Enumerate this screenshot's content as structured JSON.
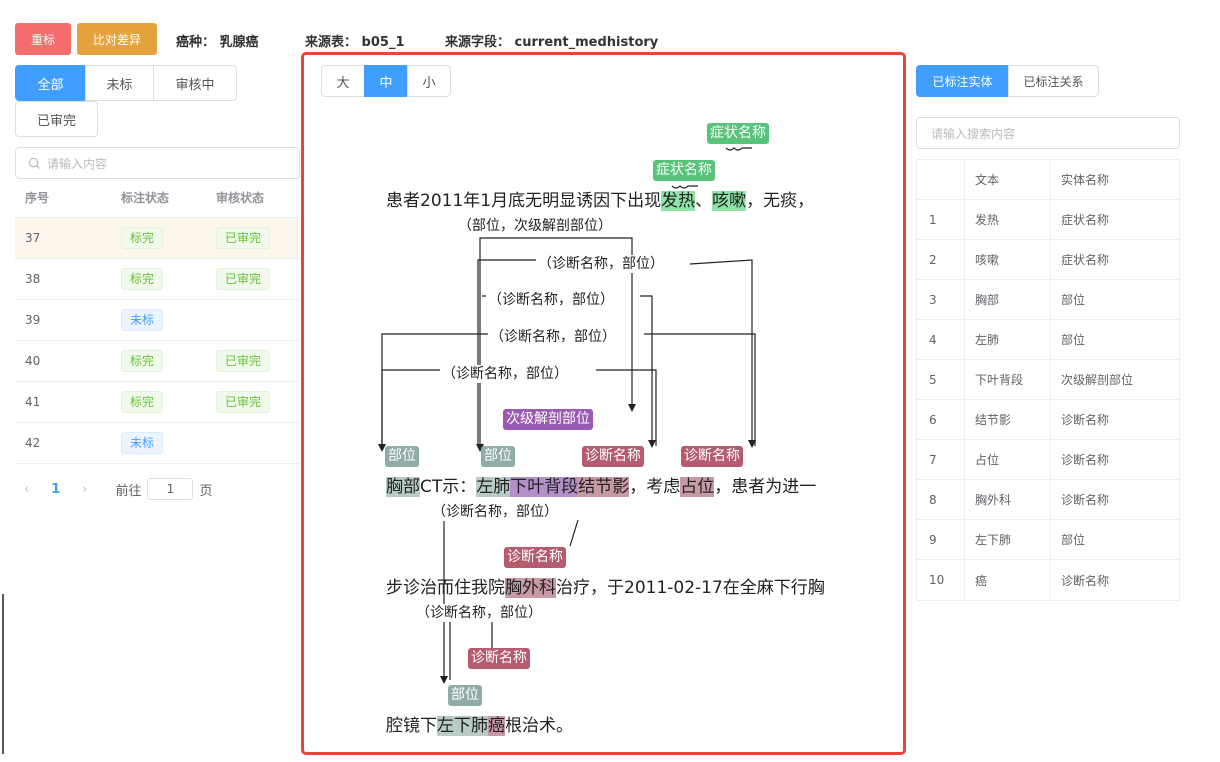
{
  "toolbar": {
    "reset_label": "重标",
    "compare_label": "比对差异",
    "cancer_type_label": "癌种：",
    "cancer_type_value": "乳腺癌",
    "source_table_label": "来源表：",
    "source_table_value": "b05_1",
    "source_field_label": "来源字段：",
    "source_field_value": "current_medhistory"
  },
  "left_panel": {
    "filters": [
      "全部",
      "未标",
      "审核中",
      "已审完"
    ],
    "search_placeholder": "请输入内容",
    "columns": [
      "序号",
      "标注状态",
      "审核状态"
    ],
    "rows": [
      {
        "id": "37",
        "label_status": "标完",
        "review_status": "已审完"
      },
      {
        "id": "38",
        "label_status": "标完",
        "review_status": "已审完"
      },
      {
        "id": "39",
        "label_status": "未标",
        "review_status": ""
      },
      {
        "id": "40",
        "label_status": "标完",
        "review_status": "已审完"
      },
      {
        "id": "41",
        "label_status": "标完",
        "review_status": "已审完"
      },
      {
        "id": "42",
        "label_status": "未标",
        "review_status": ""
      }
    ],
    "pagination": {
      "current": "1",
      "goto_label": "前往",
      "goto_value": "1",
      "page_suffix": "页"
    }
  },
  "main": {
    "size_options": [
      "大",
      "中",
      "小"
    ],
    "line1": {
      "p1": "患者2011年1月底无明显诱因下出现",
      "e1": "发热",
      "p2": "、",
      "e2": "咳嗽",
      "p3": "，无痰，"
    },
    "line2": {
      "e1": "胸部",
      "p1": "CT示：",
      "e2": "左肺",
      "e3": "下叶背段",
      "e4": "结节影",
      "p2": "，考虑",
      "e5": "占位",
      "p3": "，患者为进一"
    },
    "line3": {
      "p1": "步诊治而住我院",
      "e1": "胸外科",
      "p2": "治疗，于2011-02-17在全麻下行胸"
    },
    "line4": {
      "p1": "腔镜下",
      "e1": "左下肺",
      "e2": "癌",
      "p2": "根治术。"
    },
    "labels": {
      "symptom": "症状名称",
      "part": "部位",
      "subpart": "次级解剖部位",
      "diagnosis": "诊断名称"
    },
    "relations": {
      "r_part_subpart": "（部位，次级解剖部位）",
      "r_diag_part": "（诊断名称，部位）"
    }
  },
  "right_panel": {
    "tabs": [
      "已标注实体",
      "已标注关系"
    ],
    "search_placeholder": "请输入搜索内容",
    "columns": [
      "",
      "文本",
      "实体名称"
    ],
    "rows": [
      {
        "n": "1",
        "text": "发热",
        "entity": "症状名称"
      },
      {
        "n": "2",
        "text": "咳嗽",
        "entity": "症状名称"
      },
      {
        "n": "3",
        "text": "胸部",
        "entity": "部位"
      },
      {
        "n": "4",
        "text": "左肺",
        "entity": "部位"
      },
      {
        "n": "5",
        "text": "下叶背段",
        "entity": "次级解剖部位"
      },
      {
        "n": "6",
        "text": "结节影",
        "entity": "诊断名称"
      },
      {
        "n": "7",
        "text": "占位",
        "entity": "诊断名称"
      },
      {
        "n": "8",
        "text": "胸外科",
        "entity": "诊断名称"
      },
      {
        "n": "9",
        "text": "左下肺",
        "entity": "部位"
      },
      {
        "n": "10",
        "text": "癌",
        "entity": "诊断名称"
      }
    ]
  }
}
